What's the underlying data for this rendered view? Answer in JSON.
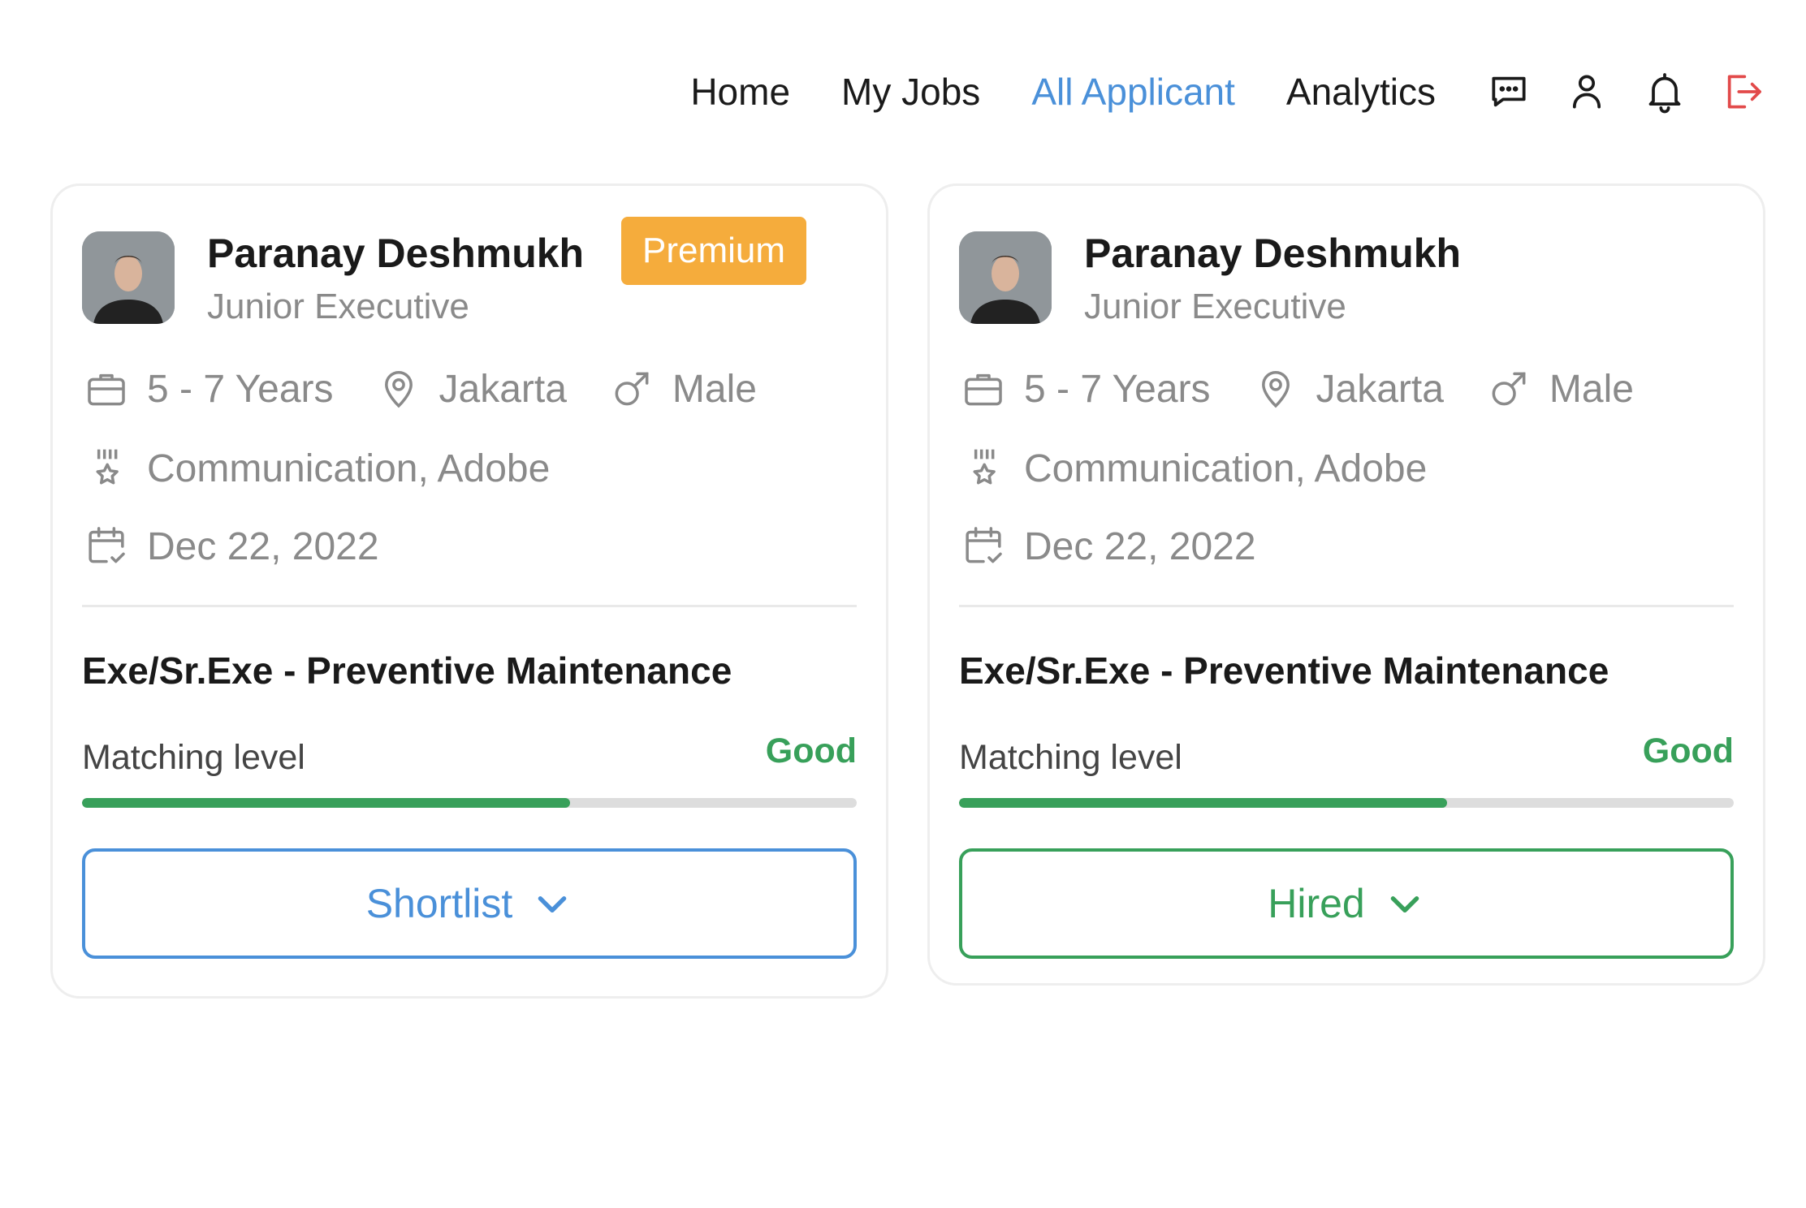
{
  "nav": {
    "links": [
      {
        "label": "Home",
        "active": false
      },
      {
        "label": "My Jobs",
        "active": false
      },
      {
        "label": "All Applicant",
        "active": true
      },
      {
        "label": "Analytics",
        "active": false
      }
    ],
    "icons": [
      "chat-icon",
      "user-icon",
      "bell-icon",
      "logout-icon"
    ]
  },
  "colors": {
    "accent_blue": "#4a90d9",
    "premium_orange": "#f5ac3c",
    "good_green": "#38a05a",
    "logout_red": "#e24a4a",
    "muted_text": "#8a8a8a"
  },
  "cards": [
    {
      "name": "Paranay Deshmukh",
      "badge": "Premium",
      "role": "Junior Executive",
      "experience": "5 - 7 Years",
      "location": "Jakarta",
      "gender": "Male",
      "skills": "Communication, Adobe",
      "date": "Dec 22, 2022",
      "job_title": "Exe/Sr.Exe - Preventive Maintenance",
      "matching_label": "Matching level",
      "matching_value": "Good",
      "matching_percent": 63,
      "status": "Shortlist",
      "status_color": "#4a90d9"
    },
    {
      "name": "Paranay Deshmukh",
      "badge": "",
      "role": "Junior Executive",
      "experience": "5 - 7 Years",
      "location": "Jakarta",
      "gender": "Male",
      "skills": "Communication, Adobe",
      "date": "Dec 22, 2022",
      "job_title": "Exe/Sr.Exe - Preventive Maintenance",
      "matching_label": "Matching level",
      "matching_value": "Good",
      "matching_percent": 63,
      "status": "Hired",
      "status_color": "#38a05a"
    }
  ]
}
